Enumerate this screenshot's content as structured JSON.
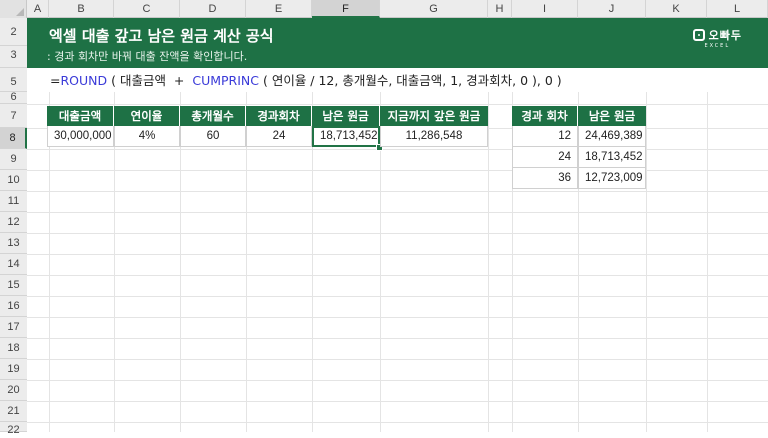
{
  "columns": [
    "A",
    "B",
    "C",
    "D",
    "E",
    "F",
    "G",
    "H",
    "I",
    "J",
    "K",
    "L"
  ],
  "selected_column": "F",
  "rows": [
    "2",
    "3",
    "5",
    "6",
    "7",
    "8",
    "9",
    "10",
    "11",
    "12",
    "13",
    "14",
    "15",
    "16",
    "17",
    "18",
    "19",
    "20",
    "21",
    "22"
  ],
  "selected_row": "8",
  "banner": {
    "title": "엑셀 대출 갚고 남은 원금 계산 공식",
    "subtitle": ": 경과 회차만 바꿔 대출 잔액을 확인합니다.",
    "logo_text": "오빠두",
    "logo_sub": "EXCEL"
  },
  "formula": {
    "p1": "=",
    "f1": "ROUND",
    "p2": " ( 대출금액  +  ",
    "f2": "CUMPRINC",
    "p3": " ( 연이율 / 12, 총개월수, 대출금액, 1, 경과회차, 0 ), 0 )"
  },
  "main_table": {
    "headers": [
      "대출금액",
      "연이율",
      "총개월수",
      "경과회차",
      "남은 원금",
      "지금까지 갚은 원금"
    ],
    "values": [
      "30,000,000",
      "4%",
      "60",
      "24",
      "18,713,452",
      "11,286,548"
    ]
  },
  "side_table": {
    "headers": [
      "경과 회차",
      "남은 원금"
    ],
    "rows": [
      [
        "12",
        "24,469,389"
      ],
      [
        "24",
        "18,713,452"
      ],
      [
        "36",
        "12,723,009"
      ]
    ]
  },
  "colors": {
    "accent": "#1e7145",
    "function": "#3a3ad8"
  }
}
